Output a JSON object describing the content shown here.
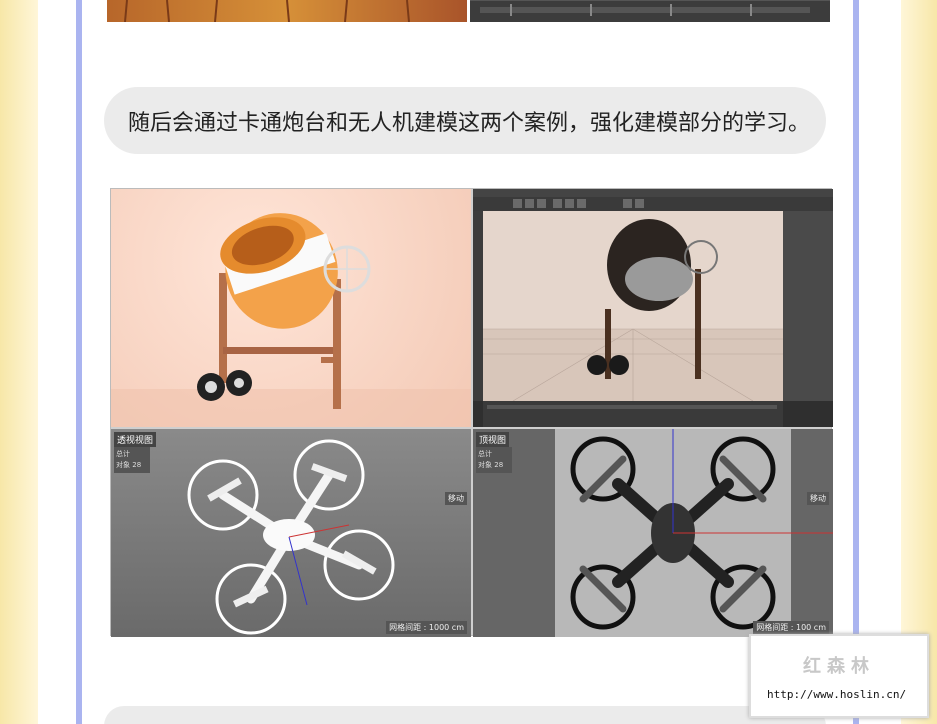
{
  "caption": "随后会通过卡通炮台和无人机建模这两个案例，强化建模部分的学习。",
  "viewports": {
    "perspective_label": "透视视图",
    "top_label": "顶视图",
    "hud_total": "总计",
    "hud_objects": "对象",
    "hud_count": "28",
    "move_label": "移动",
    "grid_left": "网格间距 : 1000 cm",
    "grid_right": "网格间距 : 100 cm"
  },
  "watermark": {
    "title": "红森林",
    "url": "http://www.hoslin.cn/"
  }
}
